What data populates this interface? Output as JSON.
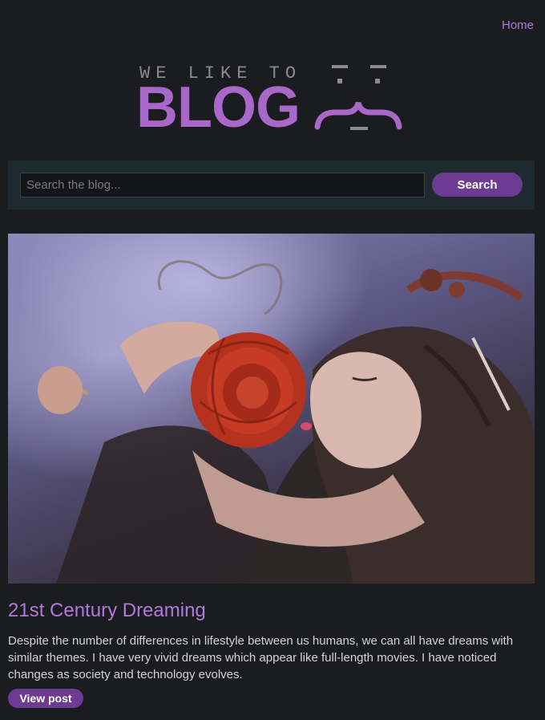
{
  "nav": {
    "home_label": "Home"
  },
  "logo": {
    "tagline": "WE LIKE TO",
    "word": "BLOG"
  },
  "search": {
    "placeholder": "Search the blog...",
    "value": "",
    "button_label": "Search"
  },
  "post": {
    "title": "21st Century Dreaming",
    "excerpt": "Despite the number of differences in lifestyle between us humans, we can all have dreams with similar themes. I have very vivid dreams which appear like full-length movies. I have noticed changes as society and technology evolves.",
    "button_label": "View post"
  },
  "colors": {
    "background": "#1b1c1f",
    "accent": "#b07ad8",
    "button": "#6d3b91",
    "search_bar": "#1f2a30"
  }
}
